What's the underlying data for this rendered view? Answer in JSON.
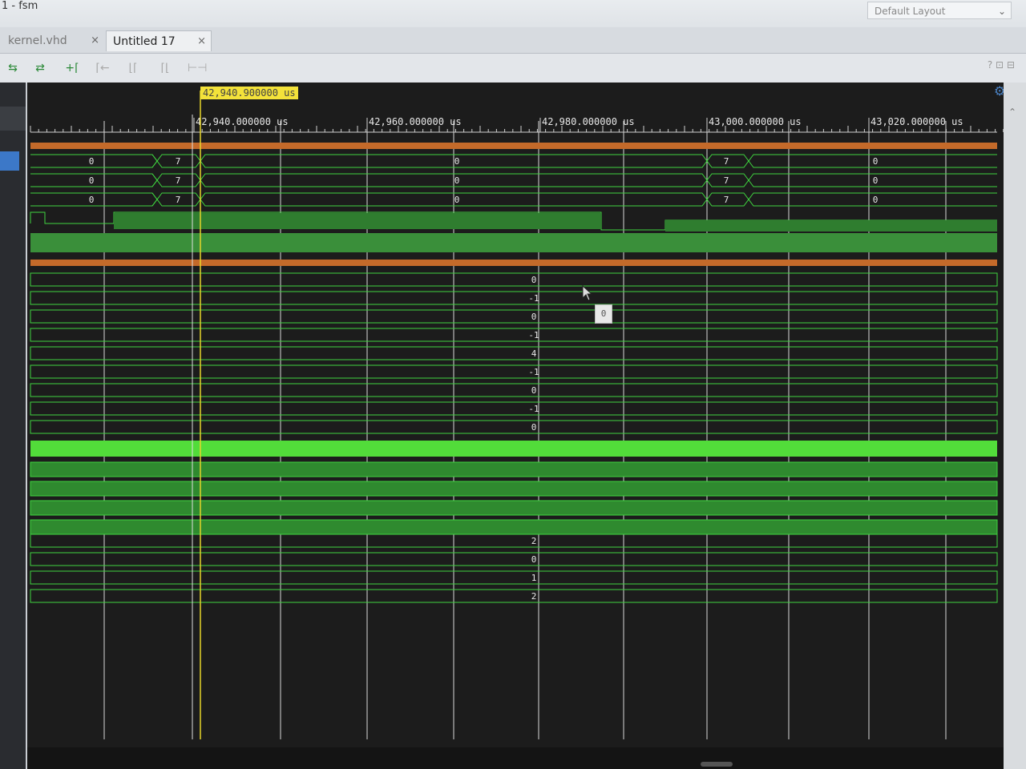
{
  "app": {
    "title": "1 - fsm"
  },
  "layout_select": {
    "value": "Default Layout"
  },
  "tabs": [
    {
      "label": "kernel.vhd",
      "active": false
    },
    {
      "label": "Untitled 17",
      "active": true
    }
  ],
  "window_controls": {
    "help": "?",
    "close": "×"
  },
  "toolbar": {
    "icons": [
      "zoom-fit-icon",
      "zoom-to-cursor-icon",
      "add-marker-icon",
      "go-first-icon",
      "go-prev-edge-icon",
      "go-next-edge-icon",
      "swap-cursor-icon"
    ],
    "right_icons": [
      "?",
      "⊡",
      "⊟"
    ]
  },
  "cursor": {
    "label": "42,940.900000 us"
  },
  "timeline": {
    "ticks": [
      "42,940.000000 us",
      "42,960.000000 us",
      "42,980.000000 us",
      "43,000.000000 us",
      "43,020.000000 us"
    ]
  },
  "buses_top": [
    {
      "values": [
        "0",
        "7",
        "0",
        "7",
        "0"
      ]
    },
    {
      "values": [
        "0",
        "7",
        "0",
        "7",
        "0"
      ]
    },
    {
      "values": [
        "0",
        "7",
        "0",
        "7",
        "0"
      ]
    }
  ],
  "register_values": [
    "0",
    "-1",
    "0",
    "-1",
    "4",
    "-1",
    "0",
    "-1",
    "0"
  ],
  "counter_values": [
    "2",
    "0",
    "1",
    "2"
  ],
  "tooltip": {
    "value": "0"
  },
  "colors": {
    "wave": "#3fd43f",
    "bus_orange": "#c46a2a",
    "cursor": "#e6d52a",
    "background": "#1c1c1c"
  }
}
